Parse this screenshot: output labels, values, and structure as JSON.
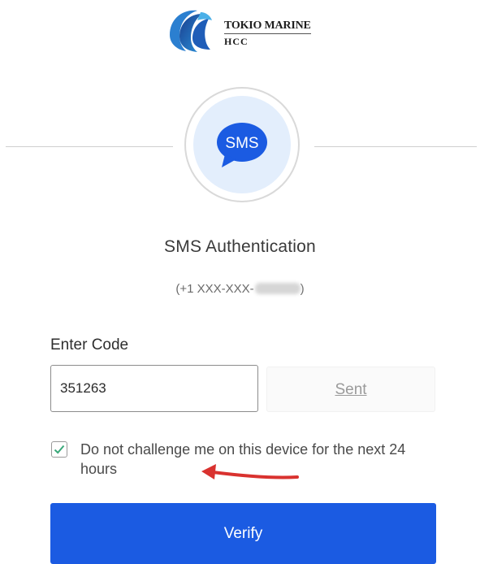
{
  "logo": {
    "line1": "TOKIO MARINE",
    "line2": "HCC"
  },
  "factor": {
    "icon_name": "sms-bubble-icon",
    "icon_label": "SMS",
    "accent_color": "#1b5be2"
  },
  "title": "SMS Authentication",
  "phone": {
    "prefix": "(+1 XXX-XXX-",
    "suffix": ")"
  },
  "code": {
    "label": "Enter Code",
    "value": "351263"
  },
  "sent_button": {
    "label": "Sent"
  },
  "remember": {
    "checked": true,
    "label": "Do not challenge me on this device for the next 24 hours"
  },
  "annotation": {
    "icon_name": "red-arrow-icon",
    "color": "#d9322f"
  },
  "verify_button": {
    "label": "Verify",
    "color": "#1b5be2"
  }
}
